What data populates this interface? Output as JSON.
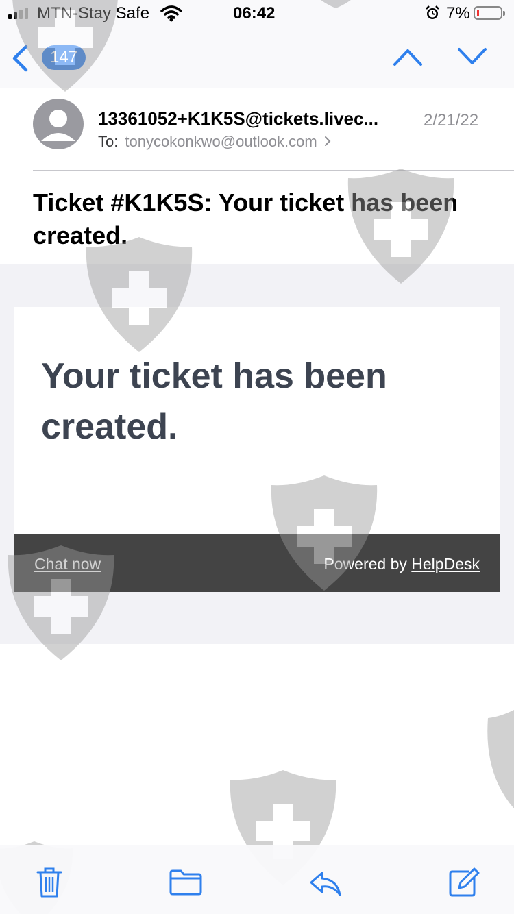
{
  "status_bar": {
    "carrier": "MTN-Stay Safe",
    "time": "06:42",
    "battery_percent": "7%",
    "icons": [
      "signal-icon",
      "wifi-icon",
      "alarm-icon",
      "battery-icon"
    ]
  },
  "nav": {
    "back_icon": "chevron-left-icon",
    "unread_count": "147",
    "prev_icon": "chevron-up-icon",
    "next_icon": "chevron-down-icon"
  },
  "message": {
    "from": "13361052+K1K5S@tickets.livec...",
    "date": "2/21/22",
    "to_label": "To:",
    "to": "tonycokonkwo@outlook.com",
    "subject": "Ticket #K1K5S: Your ticket has been created."
  },
  "body": {
    "heading": "Your ticket has been created.",
    "chat_link": "Chat now",
    "powered_by_prefix": "Powered by",
    "powered_by_link": "HelpDesk"
  },
  "toolbar": {
    "icons": [
      "trash-icon",
      "folder-icon",
      "reply-icon",
      "compose-icon"
    ]
  },
  "colors": {
    "accent": "#2f80ed",
    "heading_text": "#3d4451",
    "footer_bar": "#444444",
    "body_background": "#f2f2f6"
  }
}
